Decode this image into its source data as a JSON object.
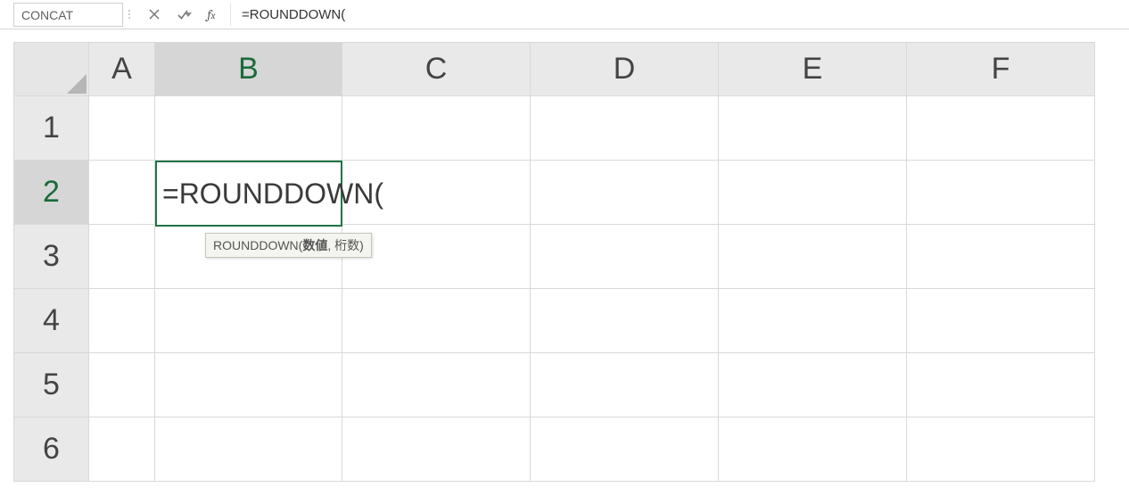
{
  "namebox": {
    "value": "CONCAT"
  },
  "formula_bar": {
    "value": "=ROUNDDOWN("
  },
  "columns": [
    "A",
    "B",
    "C",
    "D",
    "E",
    "F"
  ],
  "rows": [
    "1",
    "2",
    "3",
    "4",
    "5",
    "6"
  ],
  "active_cell": {
    "ref": "B2",
    "editing_text": "=ROUNDDOWN("
  },
  "tooltip": {
    "fn": "ROUNDDOWN",
    "arg_bold": "数値",
    "rest": ", 桁数)"
  }
}
